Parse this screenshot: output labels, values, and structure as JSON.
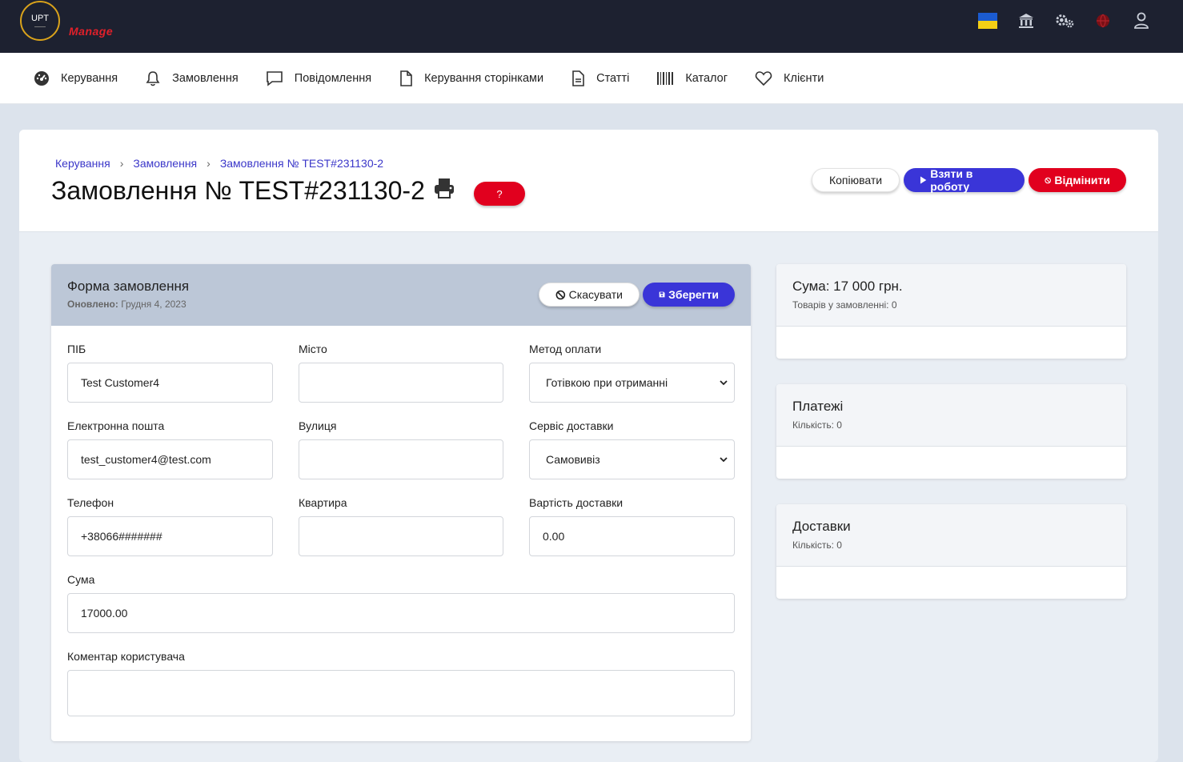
{
  "brand": {
    "logo_text": "UPT",
    "name": "Manage"
  },
  "topbar": {
    "icons": [
      "ukraine-flag",
      "bank-icon",
      "gears-icon",
      "globe-icon",
      "user-icon"
    ]
  },
  "nav": {
    "items": [
      {
        "label": "Керування",
        "icon": "dashboard-icon"
      },
      {
        "label": "Замовлення",
        "icon": "bell-icon"
      },
      {
        "label": "Повідомлення",
        "icon": "message-icon"
      },
      {
        "label": "Керування сторінками",
        "icon": "file-icon"
      },
      {
        "label": "Статті",
        "icon": "document-icon"
      },
      {
        "label": "Каталог",
        "icon": "barcode-icon"
      },
      {
        "label": "Клієнти",
        "icon": "heart-icon"
      }
    ]
  },
  "breadcrumb": [
    "Керування",
    "Замовлення",
    "Замовлення № TEST#231130-2"
  ],
  "page": {
    "title": "Замовлення № TEST#231130-2",
    "help_label": "?",
    "copy_label": "Копіювати",
    "take_label": "Взяти в роботу",
    "cancel_order_label": "Відмінити"
  },
  "form": {
    "title": "Форма замовлення",
    "updated_label": "Оновлено:",
    "updated_value": "Грудня 4, 2023",
    "cancel_label": "Скасувати",
    "save_label": "Зберегти",
    "fields": {
      "name": {
        "label": "ПІБ",
        "value": "Test Customer4"
      },
      "city": {
        "label": "Місто",
        "value": ""
      },
      "payment": {
        "label": "Метод оплати",
        "value": "Готівкою при отриманні"
      },
      "email": {
        "label": "Електронна пошта",
        "value": "test_customer4@test.com"
      },
      "street": {
        "label": "Вулиця",
        "value": ""
      },
      "delivery_service": {
        "label": "Сервіс доставки",
        "value": "Самовивіз"
      },
      "phone": {
        "label": "Телефон",
        "value": "+38066#######"
      },
      "apartment": {
        "label": "Квартира",
        "value": ""
      },
      "delivery_cost": {
        "label": "Вартість доставки",
        "value": "0.00"
      },
      "sum": {
        "label": "Сума",
        "value": "17000.00"
      },
      "comment": {
        "label": "Коментар користувача",
        "value": ""
      }
    }
  },
  "side": {
    "sum": {
      "title": "Сума: 17 000 грн.",
      "sub": "Товарів у замовленні: 0"
    },
    "payments": {
      "title": "Платежі",
      "sub": "Кількість: 0"
    },
    "deliveries": {
      "title": "Доставки",
      "sub": "Кількість: 0"
    }
  },
  "colors": {
    "accent_blue": "#3a35d8",
    "danger_red": "#e1001e",
    "topbar": "#1d2130"
  }
}
